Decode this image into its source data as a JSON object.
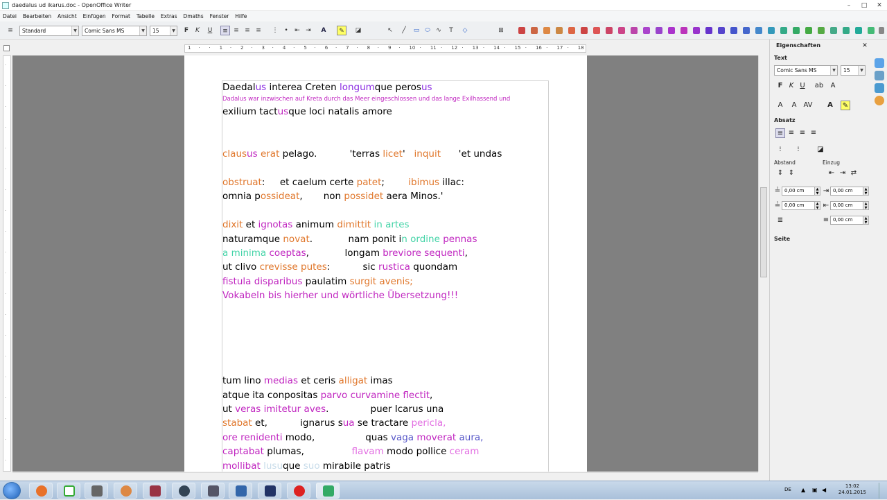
{
  "window": {
    "title": "daedalus ud ikarus.doc - OpenOffice Writer",
    "minimize": "–",
    "maximize": "□",
    "close": "✕"
  },
  "menu": [
    "Datei",
    "Bearbeiten",
    "Ansicht",
    "Einfügen",
    "Format",
    "Tabelle",
    "Extras",
    "Dmaths",
    "Fenster",
    "Hilfe"
  ],
  "toolbar": {
    "style": "Standard",
    "font": "Comic Sans MS",
    "size": "15",
    "bold": "F",
    "italic": "K",
    "underline": "U"
  },
  "ruler": {
    "ticks": [
      "1",
      "·",
      "·",
      "1",
      "·",
      "2",
      "·",
      "3",
      "·",
      "4",
      "·",
      "5",
      "·",
      "6",
      "·",
      "7",
      "·",
      "8",
      "·",
      "9",
      "·",
      "10",
      "·",
      "11",
      "·",
      "12",
      "·",
      "13",
      "·",
      "14",
      "·",
      "15",
      "·",
      "16",
      "·",
      "17",
      "·",
      "18"
    ]
  },
  "document": {
    "lines": [
      [
        {
          "t": "Daedal",
          "c": ""
        },
        {
          "t": "us",
          "c": "m"
        },
        {
          "t": " interea Creten ",
          "c": ""
        },
        {
          "t": "longum",
          "c": "m"
        },
        {
          "t": "que peros",
          "c": ""
        },
        {
          "t": "us",
          "c": "m"
        }
      ],
      [
        {
          "t": "Dadalus war inzwischen auf Kreta durch das Meer eingeschlossen und das lange Exilhassend und",
          "c": "p"
        }
      ],
      [
        {
          "t": "exilium tact",
          "c": ""
        },
        {
          "t": "us",
          "c": "p"
        },
        {
          "t": "que loci natalis amore",
          "c": ""
        }
      ],
      [
        {
          "t": "claus",
          "c": "o"
        },
        {
          "t": "us",
          "c": "p"
        },
        {
          "t": " ",
          "c": ""
        },
        {
          "t": "erat",
          "c": "o"
        },
        {
          "t": " pelago.           'terras ",
          "c": ""
        },
        {
          "t": "licet",
          "c": "o"
        },
        {
          "t": "'   ",
          "c": ""
        },
        {
          "t": "inquit",
          "c": "o"
        },
        {
          "t": "      'et undas",
          "c": ""
        }
      ],
      [
        {
          "t": "obstruat",
          "c": "o"
        },
        {
          "t": ":     et caelum certe ",
          "c": ""
        },
        {
          "t": "patet",
          "c": "o"
        },
        {
          "t": ";        ",
          "c": ""
        },
        {
          "t": "ibimus",
          "c": "o"
        },
        {
          "t": " illac:",
          "c": ""
        }
      ],
      [
        {
          "t": "omnia p",
          "c": ""
        },
        {
          "t": "ossideat",
          "c": "o"
        },
        {
          "t": ",       non ",
          "c": ""
        },
        {
          "t": "possidet",
          "c": "o"
        },
        {
          "t": " aera Minos.'",
          "c": ""
        }
      ],
      [
        {
          "t": "dixit",
          "c": "o"
        },
        {
          "t": " et ",
          "c": ""
        },
        {
          "t": "ignotas",
          "c": "p"
        },
        {
          "t": " animum ",
          "c": ""
        },
        {
          "t": "dimittit",
          "c": "o"
        },
        {
          "t": " ",
          "c": ""
        },
        {
          "t": "in artes",
          "c": "c"
        }
      ],
      [
        {
          "t": "naturamque ",
          "c": ""
        },
        {
          "t": "novat",
          "c": "o"
        },
        {
          "t": ".            nam ponit i",
          "c": ""
        },
        {
          "t": "n ordine",
          "c": "c"
        },
        {
          "t": " ",
          "c": ""
        },
        {
          "t": "pennas",
          "c": "p"
        }
      ],
      [
        {
          "t": "a minima",
          "c": "c"
        },
        {
          "t": " ",
          "c": ""
        },
        {
          "t": "coeptas",
          "c": "p"
        },
        {
          "t": ",            longam ",
          "c": ""
        },
        {
          "t": "breviore sequenti",
          "c": "p"
        },
        {
          "t": ",",
          "c": ""
        }
      ],
      [
        {
          "t": "ut clivo ",
          "c": ""
        },
        {
          "t": "crevisse putes",
          "c": "o"
        },
        {
          "t": ":           sic ",
          "c": ""
        },
        {
          "t": "rustica",
          "c": "p"
        },
        {
          "t": " quondam",
          "c": ""
        }
      ],
      [
        {
          "t": "fistula disparibus",
          "c": "p"
        },
        {
          "t": " paulatim ",
          "c": ""
        },
        {
          "t": "surgit avenis;",
          "c": "o"
        }
      ],
      [
        {
          "t": "Vokabeln bis hierher und wörtliche Übersetzung!!!",
          "c": "p"
        }
      ],
      [
        {
          "t": "tum lino ",
          "c": ""
        },
        {
          "t": "medias",
          "c": "p"
        },
        {
          "t": " et ceris ",
          "c": ""
        },
        {
          "t": "alligat",
          "c": "o"
        },
        {
          "t": " imas",
          "c": ""
        }
      ],
      [
        {
          "t": "atque ita conpositas ",
          "c": ""
        },
        {
          "t": "parvo curvamine flectit",
          "c": "p"
        },
        {
          "t": ",",
          "c": ""
        }
      ],
      [
        {
          "t": "ut ",
          "c": ""
        },
        {
          "t": "veras imitetur aves",
          "c": "p"
        },
        {
          "t": ".              puer Icarus una",
          "c": ""
        }
      ],
      [
        {
          "t": "stabat",
          "c": "o"
        },
        {
          "t": " et,           ignarus s",
          "c": ""
        },
        {
          "t": "ua",
          "c": "p"
        },
        {
          "t": " se tractare ",
          "c": ""
        },
        {
          "t": "pericla,",
          "c": "pk"
        }
      ],
      [
        {
          "t": "ore renidenti",
          "c": "p"
        },
        {
          "t": " modo,                 quas ",
          "c": ""
        },
        {
          "t": "vaga",
          "c": "bl"
        },
        {
          "t": " ",
          "c": ""
        },
        {
          "t": "moverat",
          "c": "p"
        },
        {
          "t": " ",
          "c": ""
        },
        {
          "t": "aura,",
          "c": "bl"
        }
      ],
      [
        {
          "t": "captabat",
          "c": "p"
        },
        {
          "t": " plumas,                ",
          "c": ""
        },
        {
          "t": "flavam",
          "c": "pk"
        },
        {
          "t": " modo pollice ",
          "c": ""
        },
        {
          "t": "ceram",
          "c": "pk"
        }
      ],
      [
        {
          "t": "mollibat",
          "c": "p"
        },
        {
          "t": " ",
          "c": ""
        },
        {
          "t": "lusu",
          "c": "tr"
        },
        {
          "t": "que ",
          "c": ""
        },
        {
          "t": "suo",
          "c": "tr"
        },
        {
          "t": " mirabile patris",
          "c": ""
        }
      ]
    ]
  },
  "sidebar": {
    "title": "Eigenschaften",
    "text_section": "Text",
    "font": "Comic Sans MS",
    "size": "15",
    "paragraph_section": "Absatz",
    "spacing_label": "Abstand",
    "indent_label": "Einzug",
    "values": [
      "0,00 cm",
      "0,00 cm",
      "0,00 cm",
      "0,00 cm",
      "0,00 cm"
    ],
    "page_section": "Seite"
  },
  "taskbar": {
    "lang": "DE",
    "time": "13:02",
    "date": "24.01.2015"
  }
}
